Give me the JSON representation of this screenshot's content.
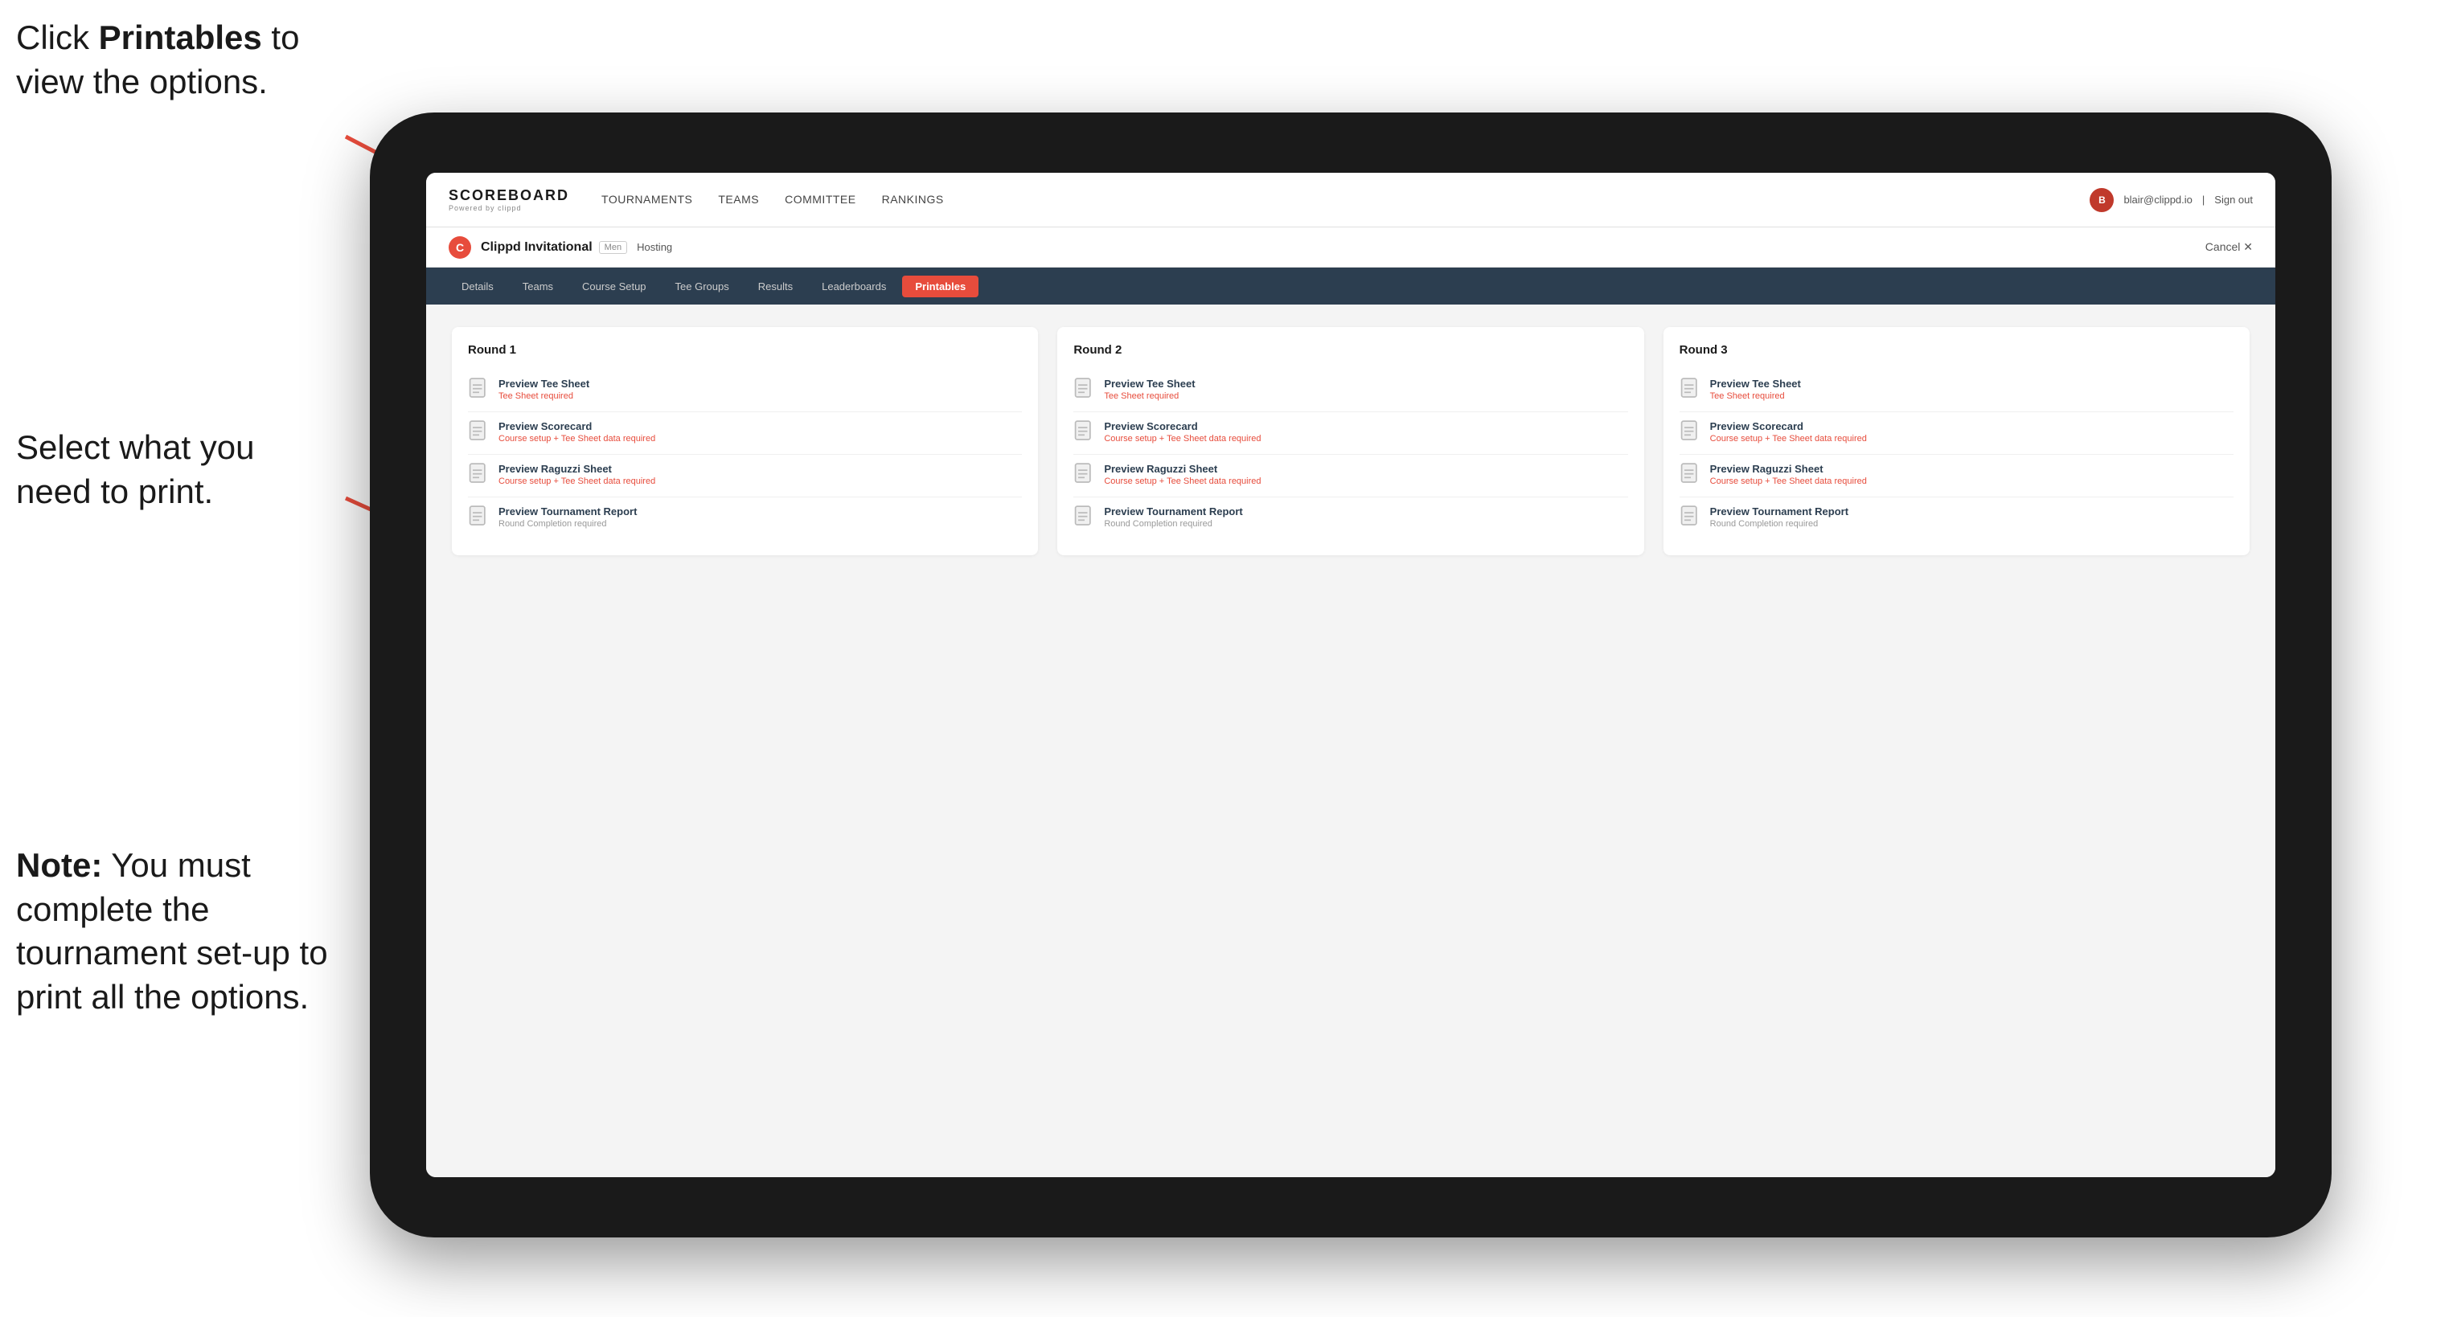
{
  "instructions": {
    "top": "Click ",
    "top_bold": "Printables",
    "top_end": " to view the options.",
    "middle": "Select what you need to print.",
    "bottom_bold": "Note:",
    "bottom_end": " You must complete the tournament set-up to print all the options."
  },
  "top_nav": {
    "logo_title": "SCOREBOARD",
    "logo_sub": "Powered by clippd",
    "links": [
      {
        "label": "TOURNAMENTS",
        "active": false
      },
      {
        "label": "TEAMS",
        "active": false
      },
      {
        "label": "COMMITTEE",
        "active": false
      },
      {
        "label": "RANKINGS",
        "active": false
      }
    ],
    "user_email": "blair@clippd.io",
    "sign_out": "Sign out",
    "user_initial": "B"
  },
  "tournament_bar": {
    "logo_letter": "C",
    "name": "Clippd Invitational",
    "badge": "Men",
    "status": "Hosting",
    "cancel": "Cancel ✕"
  },
  "sub_nav": {
    "items": [
      {
        "label": "Details",
        "active": false
      },
      {
        "label": "Teams",
        "active": false
      },
      {
        "label": "Course Setup",
        "active": false
      },
      {
        "label": "Tee Groups",
        "active": false
      },
      {
        "label": "Results",
        "active": false
      },
      {
        "label": "Leaderboards",
        "active": false
      },
      {
        "label": "Printables",
        "active": true
      }
    ]
  },
  "rounds": [
    {
      "title": "Round 1",
      "items": [
        {
          "title": "Preview Tee Sheet",
          "subtitle": "Tee Sheet required",
          "subtitle_type": "error"
        },
        {
          "title": "Preview Scorecard",
          "subtitle": "Course setup + Tee Sheet data required",
          "subtitle_type": "error"
        },
        {
          "title": "Preview Raguzzi Sheet",
          "subtitle": "Course setup + Tee Sheet data required",
          "subtitle_type": "error"
        },
        {
          "title": "Preview Tournament Report",
          "subtitle": "Round Completion required",
          "subtitle_type": "gray"
        }
      ]
    },
    {
      "title": "Round 2",
      "items": [
        {
          "title": "Preview Tee Sheet",
          "subtitle": "Tee Sheet required",
          "subtitle_type": "error"
        },
        {
          "title": "Preview Scorecard",
          "subtitle": "Course setup + Tee Sheet data required",
          "subtitle_type": "error"
        },
        {
          "title": "Preview Raguzzi Sheet",
          "subtitle": "Course setup + Tee Sheet data required",
          "subtitle_type": "error"
        },
        {
          "title": "Preview Tournament Report",
          "subtitle": "Round Completion required",
          "subtitle_type": "gray"
        }
      ]
    },
    {
      "title": "Round 3",
      "items": [
        {
          "title": "Preview Tee Sheet",
          "subtitle": "Tee Sheet required",
          "subtitle_type": "error"
        },
        {
          "title": "Preview Scorecard",
          "subtitle": "Course setup + Tee Sheet data required",
          "subtitle_type": "error"
        },
        {
          "title": "Preview Raguzzi Sheet",
          "subtitle": "Course setup + Tee Sheet data required",
          "subtitle_type": "error"
        },
        {
          "title": "Preview Tournament Report",
          "subtitle": "Round Completion required",
          "subtitle_type": "gray"
        }
      ]
    }
  ]
}
